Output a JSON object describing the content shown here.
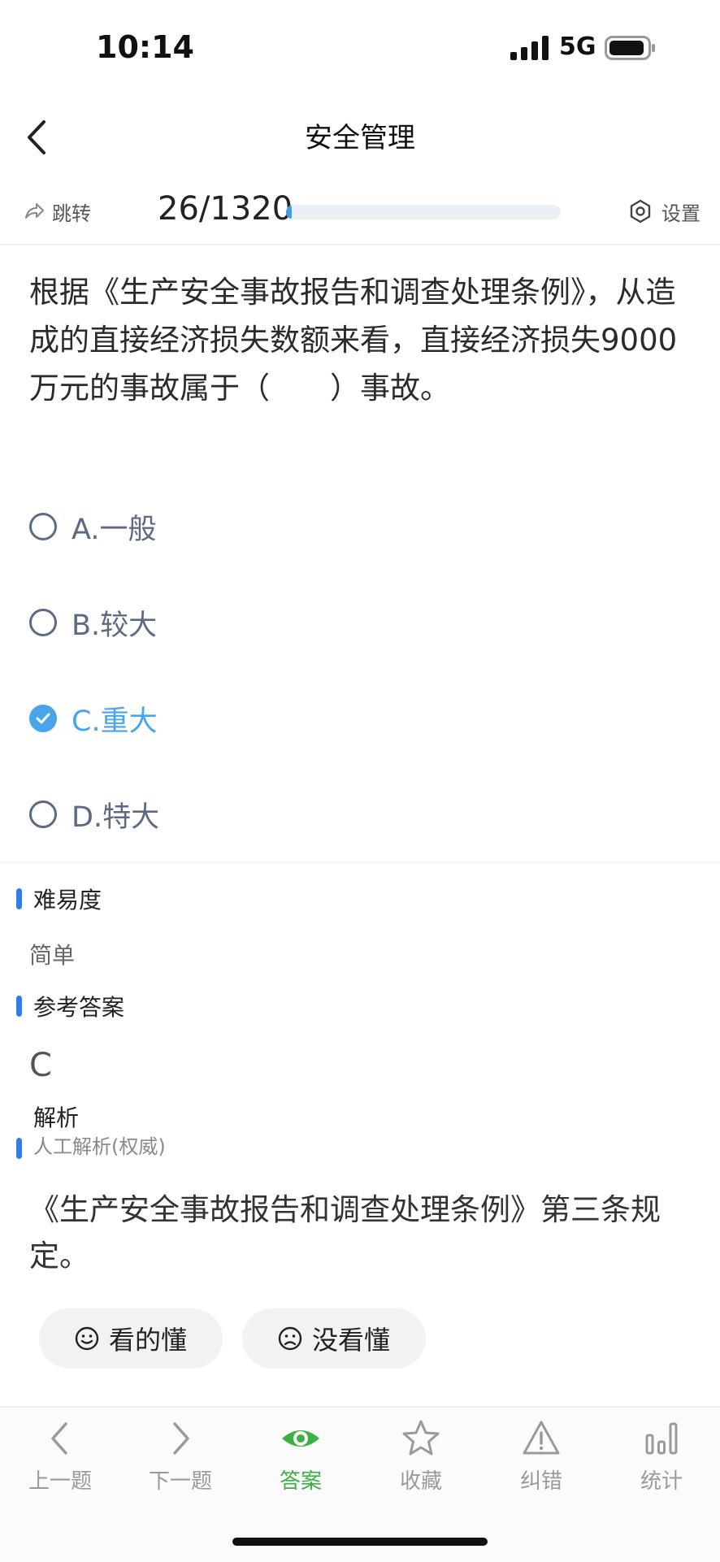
{
  "status": {
    "time": "10:14",
    "network": "5G"
  },
  "nav": {
    "title": "安全管理"
  },
  "progress": {
    "jump_label": "跳转",
    "counter": "26/1320",
    "fraction": 0.0197,
    "settings_label": "设置"
  },
  "question": {
    "text": "根据《生产安全事故报告和调查处理条例》，从造成的直接经济损失数额来看，直接经济损失9000万元的事故属于（　　）事故。",
    "options": [
      {
        "label": "A.一般",
        "selected": false
      },
      {
        "label": "B.较大",
        "selected": false
      },
      {
        "label": "C.重大",
        "selected": true
      },
      {
        "label": "D.特大",
        "selected": false
      }
    ]
  },
  "difficulty": {
    "title": "难易度",
    "value": "简单"
  },
  "reference": {
    "title": "参考答案",
    "value": "C"
  },
  "analysis": {
    "title": "解析",
    "subtitle": "人工解析(权威)",
    "text": "《生产安全事故报告和调查处理条例》第三条规定。"
  },
  "feedback": {
    "understood": "看的懂",
    "not_understood": "没看懂"
  },
  "tabs": [
    {
      "label": "上一题",
      "icon": "chevron-left-icon"
    },
    {
      "label": "下一题",
      "icon": "chevron-right-icon"
    },
    {
      "label": "答案",
      "icon": "eye-icon",
      "active": true
    },
    {
      "label": "收藏",
      "icon": "star-icon"
    },
    {
      "label": "纠错",
      "icon": "warning-icon"
    },
    {
      "label": "统计",
      "icon": "bar-chart-icon"
    }
  ],
  "colors": {
    "accent": "#48a5ea",
    "active_tab": "#3cb043",
    "section_bar": "#2f7ee8"
  }
}
